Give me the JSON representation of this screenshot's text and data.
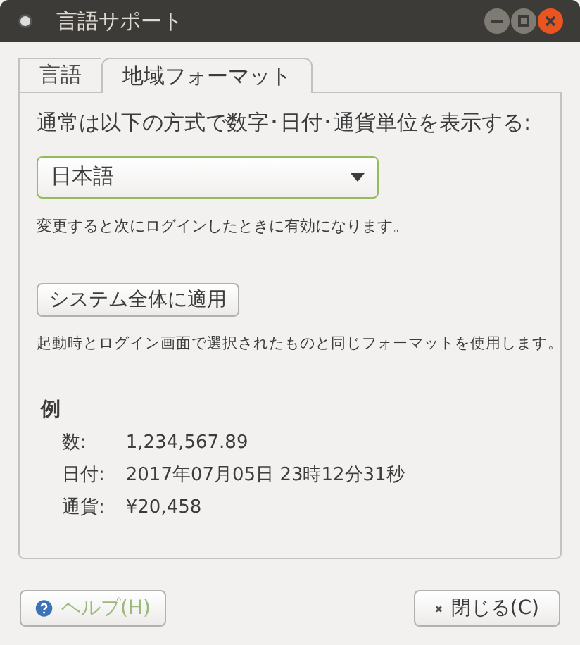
{
  "window": {
    "title": "言語サポート"
  },
  "tabs": [
    {
      "label": "言語",
      "selected": false
    },
    {
      "label": "地域フォーマット",
      "selected": true
    }
  ],
  "format_label": "通常は以下の方式で数字･日付･通貨単位を表示する:",
  "format_select": {
    "value": "日本語"
  },
  "change_note": "変更すると次にログインしたときに有効になります。",
  "apply_button": {
    "label": "システム全体に適用"
  },
  "apply_note": "起動時とログイン画面で選択されたものと同じフォーマットを使用します。",
  "example": {
    "heading": "例",
    "rows": [
      {
        "label": "数:",
        "value": "1,234,567.89"
      },
      {
        "label": "日付:",
        "value": "2017年07月05日 23時12分31秒"
      },
      {
        "label": "通貨:",
        "value": "¥20,458"
      }
    ]
  },
  "buttons": [
    {
      "label": "ヘルプ(H)",
      "kind": "help",
      "disabled": true
    },
    {
      "label": "閉じる(C)",
      "kind": "close",
      "disabled": false
    }
  ]
}
